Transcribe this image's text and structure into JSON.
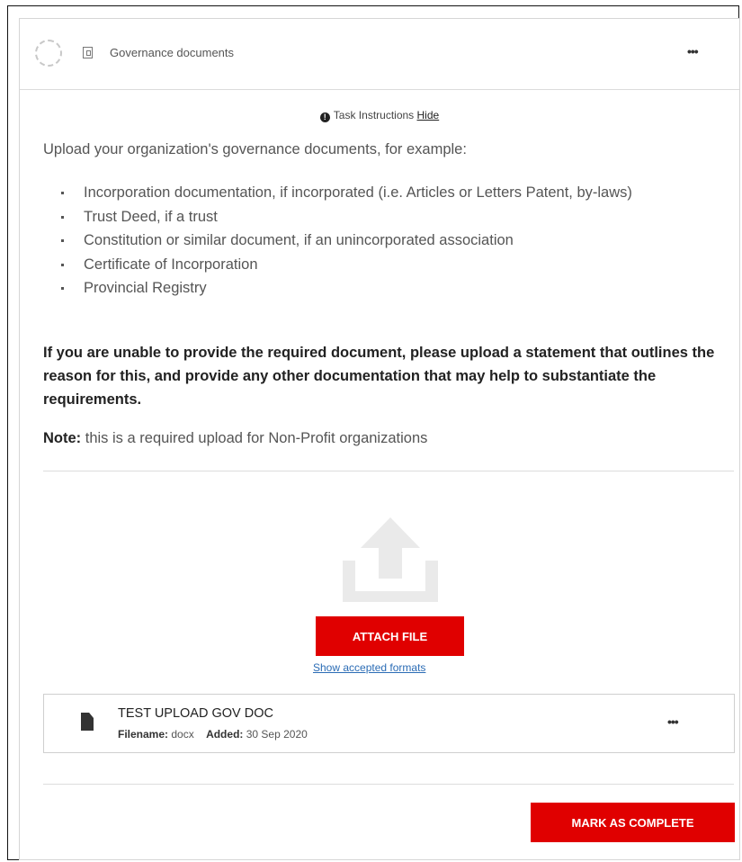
{
  "task": {
    "title": "Governance documents",
    "more_label": "•••"
  },
  "instructions": {
    "label": "Task Instructions",
    "hide_label": "Hide",
    "intro": "Upload your organization's governance documents, for example:",
    "items": [
      "Incorporation documentation, if incorporated (i.e. Articles or Letters Patent, by-laws)",
      "Trust Deed, if a trust",
      "Constitution or similar document, if an unincorporated association",
      "Certificate of Incorporation",
      "Provincial Registry"
    ],
    "statement": "If you are unable to provide the required document, please upload a statement that outlines the reason for this, and provide any other documentation that may help to substantiate the requirements.",
    "note_label": "Note:",
    "note_text": " this is a required upload for Non-Profit organizations"
  },
  "upload": {
    "attach_label": "ATTACH FILE",
    "formats_link": "Show accepted formats"
  },
  "file": {
    "title": "TEST UPLOAD GOV DOC",
    "filename_label": "Filename:",
    "filename_value": "docx",
    "added_label": "Added:",
    "added_value": "30 Sep 2020",
    "more_label": "•••"
  },
  "footer": {
    "complete_label": "MARK AS COMPLETE"
  },
  "colors": {
    "accent": "#e00000",
    "link": "#2b6cb5"
  }
}
